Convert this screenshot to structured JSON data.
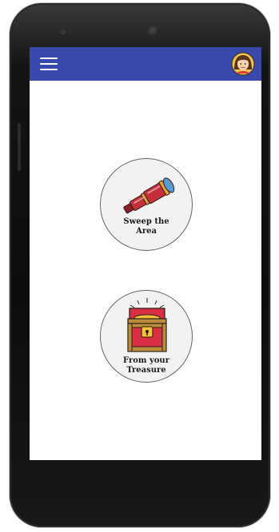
{
  "app": {
    "menu_icon": "menu-icon",
    "avatar_icon": "avatar-icon",
    "header_color": "#3949ab"
  },
  "actions": [
    {
      "label_line1": "Sweep the",
      "label_line2": "Area",
      "icon": "telescope-icon"
    },
    {
      "label_line1": "From your",
      "label_line2": "Treasure",
      "icon": "treasure-chest-icon"
    }
  ]
}
